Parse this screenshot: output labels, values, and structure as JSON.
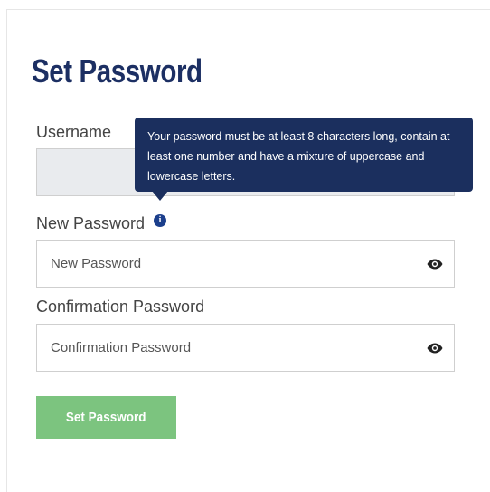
{
  "form": {
    "title": "Set Password",
    "username": {
      "label": "Username",
      "value": "",
      "disabled": true
    },
    "new_password": {
      "label": "New Password",
      "placeholder": "New Password",
      "value": ""
    },
    "confirmation_password": {
      "label": "Confirmation Password",
      "placeholder": "Confirmation Password",
      "value": ""
    },
    "submit_label": "Set Password"
  },
  "tooltip": {
    "text": "Your password must be at least 8 characters long, contain at least one number and have a mixture of uppercase and lowercase letters."
  },
  "icons": {
    "info": "info-icon",
    "eye": "eye-icon"
  },
  "colors": {
    "title": "#1c2f63",
    "tooltip_bg": "#1b2f5e",
    "info_icon": "#1c3f8c",
    "submit_bg": "#7cc47f",
    "disabled_field_bg": "#e9ebee"
  }
}
